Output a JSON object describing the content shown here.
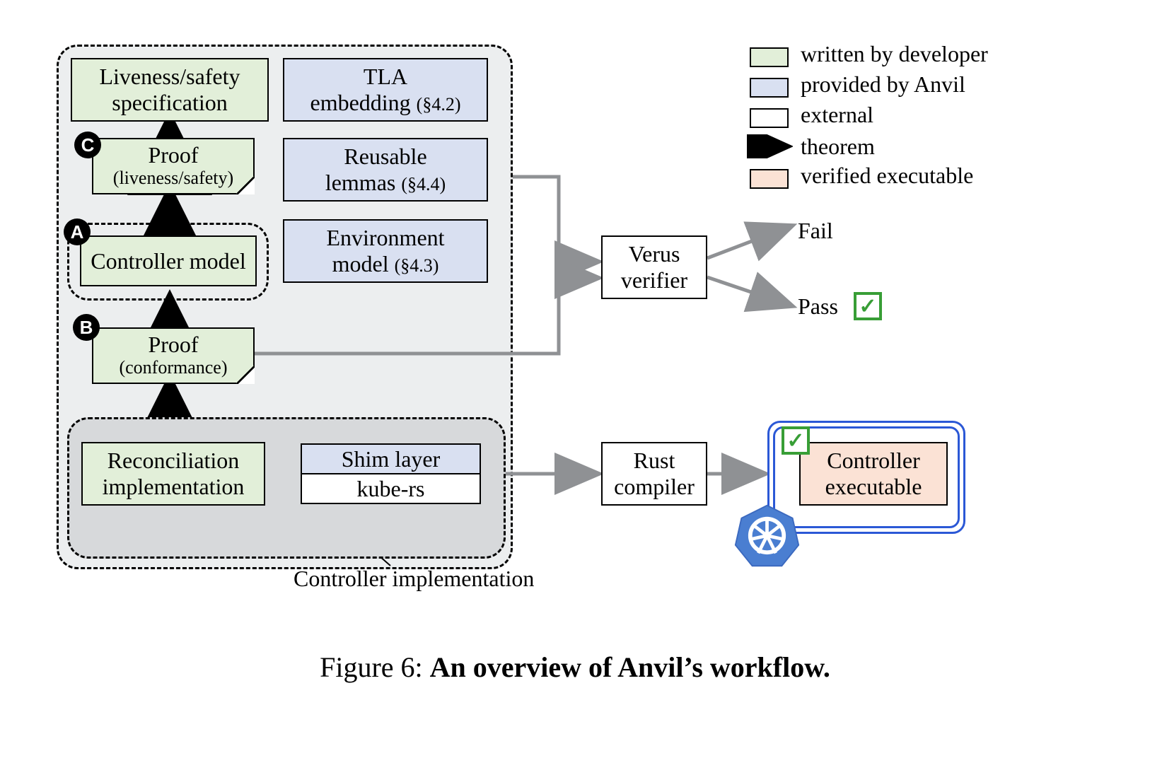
{
  "boxes": {
    "liveness_spec_l1": "Liveness/safety",
    "liveness_spec_l2": "specification",
    "tla_l1": "TLA",
    "tla_l2a": "embedding ",
    "tla_l2b": "(§4.2)",
    "proof_ls_main": "Proof",
    "proof_ls_sub": "(liveness/safety)",
    "lemmas_l1": "Reusable",
    "lemmas_l2a": "lemmas ",
    "lemmas_l2b": "(§4.4)",
    "ctrl_model": "Controller model",
    "env_l1": "Environment",
    "env_l2a": "model ",
    "env_l2b": "(§4.3)",
    "proof_conf_main": "Proof",
    "proof_conf_sub": "(conformance)",
    "reconcile_l1": "Reconciliation",
    "reconcile_l2": "implementation",
    "shim": "Shim layer",
    "kubers": "kube-rs",
    "verus_l1": "Verus",
    "verus_l2": "verifier",
    "rust_l1": "Rust",
    "rust_l2": "compiler",
    "exec_l1": "Controller",
    "exec_l2": "executable"
  },
  "badges": {
    "a": "A",
    "b": "B",
    "c": "C"
  },
  "labels": {
    "ctrl_impl": "Controller implementation",
    "fail": "Fail",
    "pass": "Pass"
  },
  "legend": {
    "dev": "written by developer",
    "anvil": "provided by Anvil",
    "ext": "external",
    "theorem": "theorem",
    "verified": "verified executable"
  },
  "caption_prefix": "Figure 6: ",
  "caption_bold": "An overview of Anvil’s workflow.",
  "workflow_description": {
    "developer_artifacts": [
      "Liveness/safety specification",
      "Proof (liveness/safety)",
      "Controller model",
      "Proof (conformance)",
      "Reconciliation implementation"
    ],
    "anvil_artifacts": [
      "TLA embedding (§4.2)",
      "Reusable lemmas (§4.4)",
      "Environment model (§4.3)",
      "Shim layer"
    ],
    "external_artifacts": [
      "kube-rs",
      "Verus verifier",
      "Rust compiler"
    ],
    "verified_artifacts": [
      "Controller executable"
    ],
    "theorem_edges": [
      [
        "Proof (liveness/safety)",
        "Liveness/safety specification"
      ],
      [
        "Controller model",
        "Proof (liveness/safety)"
      ],
      [
        "Proof (conformance)",
        "Controller model"
      ],
      [
        "Reconciliation implementation",
        "Proof (conformance)"
      ]
    ],
    "dataflow_edges": [
      [
        "proof/spec group",
        "Verus verifier"
      ],
      [
        "Verus verifier",
        "Fail"
      ],
      [
        "Verus verifier",
        "Pass"
      ],
      [
        "controller implementation group",
        "Rust compiler"
      ],
      [
        "Rust compiler",
        "Controller executable"
      ]
    ],
    "badge_map": {
      "A": "Controller model",
      "B": "Proof (conformance)",
      "C": "Proof (liveness/safety)"
    }
  }
}
